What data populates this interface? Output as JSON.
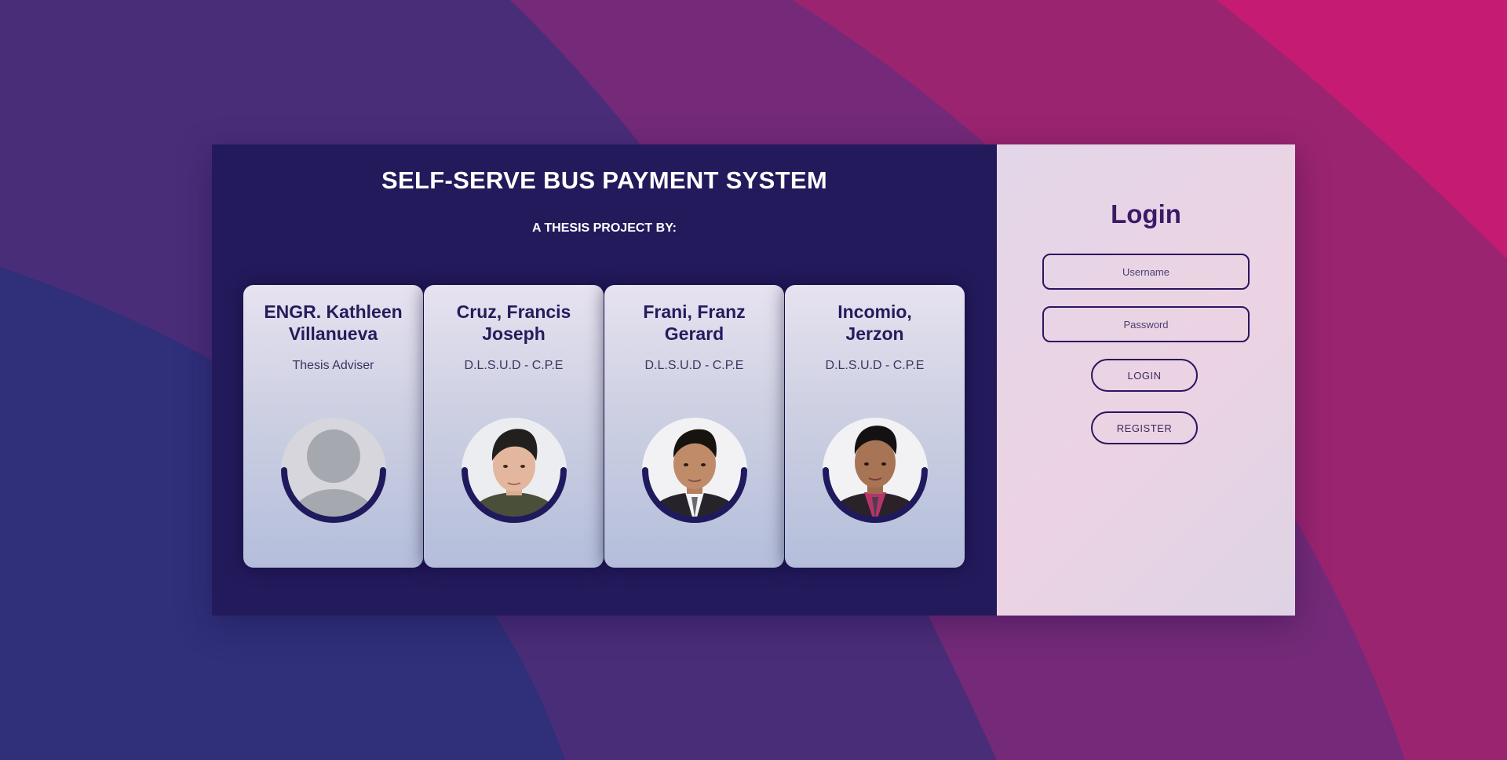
{
  "header": {
    "title": "SELF-SERVE BUS PAYMENT SYSTEM",
    "subtitle": "A THESIS PROJECT BY:"
  },
  "team": [
    {
      "name_line1": "ENGR. Kathleen",
      "name_line2": "Villanueva",
      "role": "Thesis Adviser",
      "photo": "placeholder-avatar-icon"
    },
    {
      "name_line1": "Cruz, Francis",
      "name_line2": "Joseph",
      "role": "D.L.S.U.D - C.P.E",
      "photo": "member-photo"
    },
    {
      "name_line1": "Frani, Franz",
      "name_line2": "Gerard",
      "role": "D.L.S.U.D - C.P.E",
      "photo": "member-photo"
    },
    {
      "name_line1": "Incomio,",
      "name_line2": "Jerzon",
      "role": "D.L.S.U.D - C.P.E",
      "photo": "member-photo"
    }
  ],
  "login": {
    "title": "Login",
    "username_placeholder": "Username",
    "username_value": "",
    "password_placeholder": "Password",
    "password_value": "",
    "login_label": "LOGIN",
    "register_label": "REGISTER"
  },
  "colors": {
    "left_panel": "#231a5c",
    "accent_ring": "#1f1a5e",
    "login_text": "#3a1a66",
    "bg_blue": "#2f2f7a",
    "bg_purple": "#4a2d78",
    "bg_magenta": "#9b2470",
    "bg_pink": "#c51b72"
  }
}
